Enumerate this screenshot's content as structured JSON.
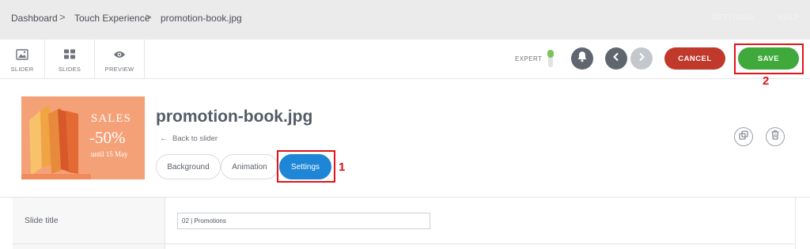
{
  "breadcrumb": {
    "items": [
      "Dashboard",
      "Touch Experience",
      "promotion-book.jpg"
    ],
    "separator": ">"
  },
  "top_links": {
    "settings": "SETTINGS",
    "help": "HELP"
  },
  "toolbar": {
    "tools": [
      {
        "label": "SLIDER",
        "icon": "image-icon"
      },
      {
        "label": "SLIDES",
        "icon": "grid-icon"
      },
      {
        "label": "PREVIEW",
        "icon": "eye-icon"
      }
    ],
    "expert_label": "EXPERT",
    "cancel_label": "CANCEL",
    "save_label": "SAVE"
  },
  "annotations": {
    "settings_number": "1",
    "save_number": "2"
  },
  "slide": {
    "title": "promotion-book.jpg",
    "back_label": "Back to slider",
    "thumbnail": {
      "line1": "SALES",
      "line2": "-50%",
      "line3": "until 15 May"
    },
    "tabs": [
      "Background",
      "Animation",
      "Settings"
    ],
    "active_tab": "Settings"
  },
  "settings": {
    "rows": [
      {
        "label": "Slide title",
        "value": "02 | Promotions"
      }
    ]
  },
  "colors": {
    "save": "#3faa3b",
    "cancel": "#c0392b",
    "active_tab": "#1d86d6",
    "annotation": "#e0141a",
    "thumbnail_bg": "#f5a178"
  }
}
